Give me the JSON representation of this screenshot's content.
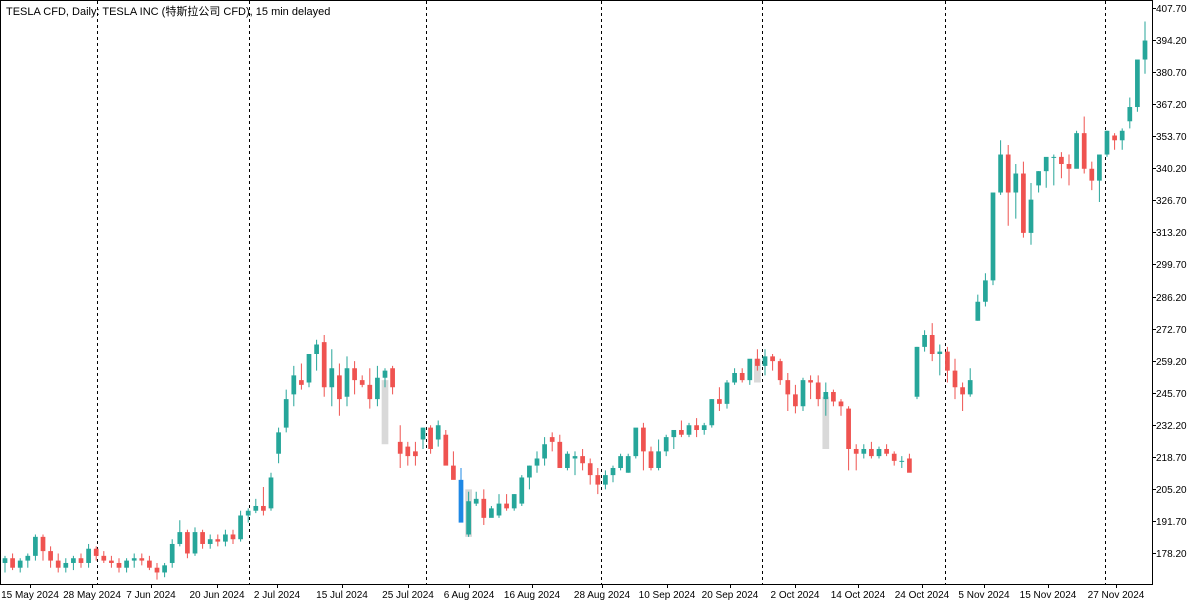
{
  "title": "TESLA CFD, Daily:  TESLA INC (特斯拉公司 CFD), 15 min delayed",
  "colors": {
    "up": "#26a69a",
    "down": "#ef5350",
    "highlight_up": "#1e88e5",
    "shade": "#d9d9d9",
    "grid": "#000000",
    "axis": "#000000"
  },
  "chart_data": {
    "type": "candlestick",
    "symbol": "TESLA CFD",
    "timeframe": "Daily",
    "y_ticks": [
      178.2,
      191.7,
      205.2,
      218.7,
      232.2,
      245.7,
      259.2,
      272.7,
      286.2,
      299.7,
      313.2,
      326.7,
      340.2,
      353.7,
      367.2,
      380.7,
      394.2,
      407.7
    ],
    "y_tick_labels": [
      "178.20",
      "191.70",
      "205.20",
      "218.70",
      "232.20",
      "245.70",
      "259.20",
      "272.70",
      "286.20",
      "299.70",
      "313.20",
      "326.70",
      "340.20",
      "353.70",
      "367.20",
      "380.70",
      "394.20",
      "407.70"
    ],
    "ylim": [
      168.9,
      407.7
    ],
    "x_tick_labels": [
      "15 May 2024",
      "28 May 2024",
      "7 Jun 2024",
      "20 Jun 2024",
      "2 Jul 2024",
      "15 Jul 2024",
      "25 Jul 2024",
      "6 Aug 2024",
      "16 Aug 2024",
      "28 Aug 2024",
      "10 Sep 2024",
      "20 Sep 2024",
      "2 Oct 2024",
      "14 Oct 2024",
      "24 Oct 2024",
      "5 Nov 2024",
      "15 Nov 2024",
      "27 Nov 2024"
    ],
    "candles": [
      [
        174,
        177,
        170,
        176
      ],
      [
        176,
        178,
        171,
        172
      ],
      [
        172,
        176,
        170,
        175
      ],
      [
        175,
        178,
        172,
        177
      ],
      [
        177,
        186,
        175,
        185
      ],
      [
        185,
        186,
        175,
        179
      ],
      [
        179,
        181,
        172,
        175
      ],
      [
        175,
        178,
        170,
        172
      ],
      [
        172,
        176,
        170,
        174
      ],
      [
        174,
        177,
        171,
        176
      ],
      [
        176,
        178,
        172,
        174
      ],
      [
        174,
        182,
        172,
        180
      ],
      [
        180,
        181,
        175,
        177
      ],
      [
        177,
        179,
        174,
        175
      ],
      [
        175,
        177,
        172,
        174
      ],
      [
        174,
        176,
        170,
        172
      ],
      [
        172,
        176,
        170,
        175
      ],
      [
        175,
        178,
        172,
        176
      ],
      [
        176,
        178,
        173,
        175
      ],
      [
        175,
        177,
        171,
        172
      ],
      [
        172,
        174,
        167,
        170
      ],
      [
        170,
        174,
        168,
        173
      ],
      [
        174,
        184,
        172,
        182
      ],
      [
        182,
        192,
        181,
        187
      ],
      [
        187,
        188,
        176,
        178
      ],
      [
        178,
        189,
        177,
        187
      ],
      [
        187,
        188,
        180,
        182
      ],
      [
        182,
        186,
        180,
        184
      ],
      [
        184,
        186,
        181,
        183
      ],
      [
        183,
        188,
        181,
        186
      ],
      [
        186,
        188,
        182,
        184
      ],
      [
        184,
        196,
        183,
        194
      ],
      [
        194,
        197,
        191,
        196
      ],
      [
        196,
        201,
        195,
        198
      ],
      [
        198,
        206,
        194,
        196
      ],
      [
        197,
        212,
        196,
        210
      ],
      [
        220,
        231,
        216,
        229
      ],
      [
        231,
        247,
        229,
        243
      ],
      [
        245,
        257,
        240,
        253
      ],
      [
        251,
        258,
        247,
        249
      ],
      [
        250,
        261,
        248,
        262
      ],
      [
        262,
        268,
        255,
        266
      ],
      [
        267,
        270,
        244,
        248
      ],
      [
        248,
        264,
        240,
        256
      ],
      [
        253,
        258,
        236,
        243
      ],
      [
        244,
        261,
        240,
        256
      ],
      [
        256,
        259,
        245,
        251
      ],
      [
        251,
        253,
        248,
        249
      ],
      [
        249,
        256,
        239,
        243
      ],
      [
        243,
        257,
        240,
        252
      ],
      [
        252,
        256,
        248,
        255
      ],
      [
        256,
        257,
        245,
        248
      ],
      [
        225,
        232,
        214,
        220
      ],
      [
        223,
        225,
        215,
        219
      ],
      [
        221,
        225,
        215,
        219
      ],
      [
        226,
        231,
        222,
        231
      ],
      [
        231,
        232,
        220,
        222
      ],
      [
        226,
        234,
        223,
        232
      ],
      [
        228,
        230,
        218,
        215
      ],
      [
        215,
        221,
        210,
        209
      ],
      [
        209,
        214,
        196,
        191
      ],
      [
        186,
        204,
        185,
        200
      ],
      [
        199,
        204,
        198,
        201
      ],
      [
        201,
        205,
        190,
        193
      ],
      [
        193,
        198,
        194,
        197
      ],
      [
        194,
        203,
        193,
        199
      ],
      [
        199,
        203,
        196,
        197
      ],
      [
        197,
        203,
        196,
        203
      ],
      [
        199,
        211,
        198,
        210
      ],
      [
        210,
        215,
        205,
        215
      ],
      [
        215,
        221,
        212,
        218
      ],
      [
        218,
        227,
        215,
        224
      ],
      [
        227,
        229,
        221,
        225
      ],
      [
        225,
        228,
        214,
        214
      ],
      [
        214,
        221,
        213,
        220
      ],
      [
        218,
        221,
        211,
        219
      ],
      [
        219,
        222,
        213,
        216
      ],
      [
        216,
        218,
        207,
        211
      ],
      [
        211,
        214,
        203,
        207
      ],
      [
        207,
        213,
        205,
        211
      ],
      [
        211,
        215,
        208,
        214
      ],
      [
        214,
        220,
        213,
        219
      ],
      [
        212,
        220,
        212,
        219
      ],
      [
        219,
        229,
        218,
        231
      ],
      [
        231,
        233,
        213,
        221
      ],
      [
        221,
        223,
        213,
        214
      ],
      [
        214,
        226,
        213,
        221
      ],
      [
        221,
        228,
        219,
        227
      ],
      [
        227,
        229,
        222,
        230
      ],
      [
        230,
        234,
        227,
        228
      ],
      [
        228,
        233,
        227,
        232
      ],
      [
        232,
        235,
        227,
        230
      ],
      [
        230,
        233,
        228,
        232
      ],
      [
        232,
        243,
        231,
        243
      ],
      [
        243,
        248,
        238,
        241
      ],
      [
        241,
        251,
        239,
        250
      ],
      [
        250,
        256,
        249,
        254
      ],
      [
        254,
        256,
        250,
        251
      ],
      [
        251,
        258,
        249,
        260
      ],
      [
        260,
        264,
        255,
        257
      ],
      [
        257,
        264,
        253,
        261
      ],
      [
        261,
        262,
        255,
        259
      ],
      [
        259,
        260,
        249,
        251
      ],
      [
        251,
        254,
        238,
        245
      ],
      [
        245,
        249,
        237,
        240
      ],
      [
        240,
        252,
        238,
        251
      ],
      [
        251,
        253,
        243,
        250
      ],
      [
        250,
        253,
        240,
        243
      ],
      [
        243,
        250,
        236,
        246
      ],
      [
        246,
        247,
        240,
        242
      ],
      [
        242,
        243,
        236,
        240
      ],
      [
        239,
        240,
        213,
        222
      ],
      [
        222,
        224,
        213,
        220
      ],
      [
        220,
        224,
        218,
        222
      ],
      [
        222,
        225,
        218,
        219
      ],
      [
        219,
        223,
        218,
        222
      ],
      [
        222,
        224,
        219,
        220
      ],
      [
        220,
        221,
        215,
        217
      ],
      [
        217,
        219,
        214,
        217
      ],
      [
        218,
        220,
        214,
        212
      ],
      [
        244,
        265,
        243,
        265
      ],
      [
        265,
        272,
        263,
        270
      ],
      [
        270,
        275,
        259,
        262
      ],
      [
        262,
        266,
        253,
        263
      ],
      [
        263,
        265,
        250,
        255
      ],
      [
        255,
        260,
        243,
        248
      ],
      [
        248,
        250,
        238,
        245
      ],
      [
        245,
        256,
        244,
        251
      ],
      [
        276,
        287,
        276,
        284
      ],
      [
        284,
        296,
        282,
        293
      ],
      [
        293,
        326,
        291,
        330
      ],
      [
        330,
        352,
        329,
        346
      ],
      [
        346,
        350,
        316,
        330
      ],
      [
        330,
        342,
        319,
        338
      ],
      [
        338,
        343,
        311,
        313
      ],
      [
        313,
        334,
        308,
        327
      ],
      [
        333,
        339,
        330,
        339
      ],
      [
        339,
        342,
        332,
        345
      ],
      [
        345,
        346,
        333,
        345
      ],
      [
        345,
        347,
        336,
        342
      ],
      [
        342,
        346,
        333,
        340
      ],
      [
        340,
        356,
        341,
        355
      ],
      [
        355,
        362,
        338,
        340
      ],
      [
        340,
        343,
        331,
        335
      ],
      [
        335,
        337,
        326,
        346
      ],
      [
        346,
        356,
        345,
        356
      ],
      [
        354,
        355,
        348,
        352
      ],
      [
        352,
        357,
        348,
        356
      ],
      [
        360,
        370,
        357,
        366
      ],
      [
        366,
        384,
        364,
        386
      ],
      [
        386,
        402,
        380,
        394
      ]
    ],
    "highlights": [
      {
        "type": "shade",
        "from_candle": 50,
        "to_candle": 50,
        "y_from": 224,
        "y_to": 251
      },
      {
        "type": "up-candle",
        "candle": 60,
        "y_from": 185,
        "y_to": 204
      },
      {
        "type": "shade",
        "from_candle": 61,
        "to_candle": 61,
        "y_from": 185,
        "y_to": 205
      },
      {
        "type": "shade",
        "from_candle": 99,
        "to_candle": 99,
        "y_from": 250,
        "y_to": 260
      },
      {
        "type": "shade",
        "from_candle": 108,
        "to_candle": 108,
        "y_from": 222,
        "y_to": 244
      }
    ]
  }
}
